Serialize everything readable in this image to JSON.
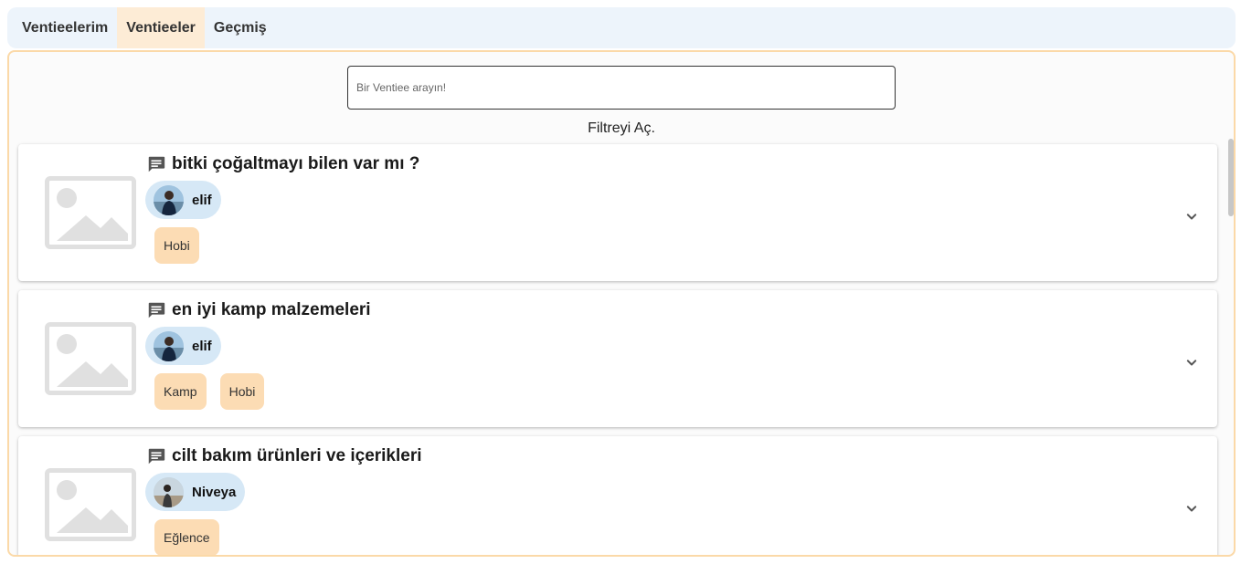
{
  "tabs": [
    {
      "label": "Ventieelerim",
      "active": false
    },
    {
      "label": "Ventieeler",
      "active": true
    },
    {
      "label": "Geçmiş",
      "active": false
    }
  ],
  "search": {
    "placeholder": "Bir Ventiee arayın!",
    "value": ""
  },
  "filter_label": "Filtreyi Aç.",
  "posts": [
    {
      "title": "bitki çoğaltmayı bilen var mı ?",
      "user": "elif",
      "tags": [
        "Hobi"
      ]
    },
    {
      "title": "en iyi kamp malzemeleri",
      "user": "elif",
      "tags": [
        "Kamp",
        "Hobi"
      ]
    },
    {
      "title": "cilt bakım ürünleri ve içerikleri",
      "user": "Niveya",
      "tags": [
        "Eğlence"
      ]
    }
  ],
  "icons": {
    "post": "chat-bubble-icon",
    "expand": "chevron-down-icon",
    "thumbnail": "image-placeholder-icon"
  },
  "colors": {
    "tabbar_bg": "#edf4fb",
    "active_tab_bg": "#fdecd6",
    "panel_border": "#fbd9a8",
    "user_chip_bg": "#d6e8f6",
    "tag_bg": "#fcdcb4"
  }
}
